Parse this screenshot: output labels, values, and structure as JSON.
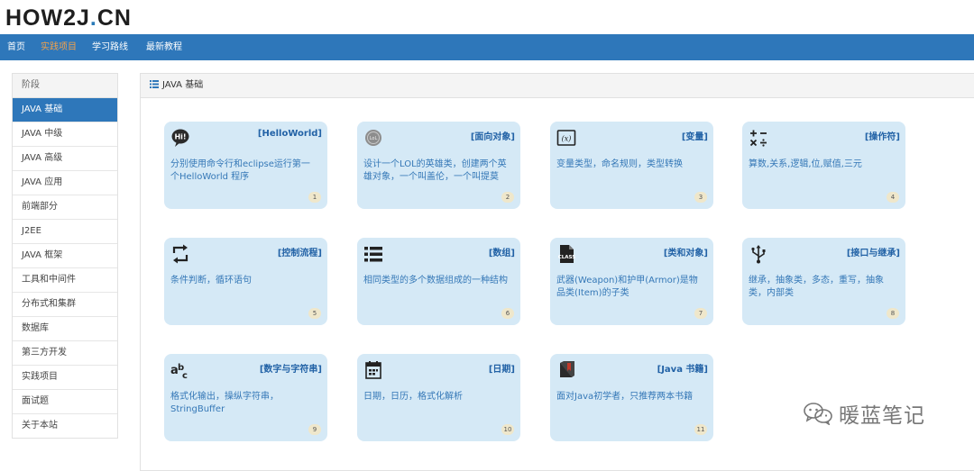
{
  "logo": {
    "text_a": "HOW2J",
    "text_dot": ".",
    "text_b": "CN"
  },
  "nav": {
    "items": [
      {
        "label": "首页",
        "active": false
      },
      {
        "label": "实践项目",
        "active": true
      },
      {
        "label": "学习路线",
        "active": false
      },
      {
        "label": "最新教程",
        "active": false
      }
    ]
  },
  "colors": {
    "nav_bg": "#2e77ba",
    "nav_active": "#f3a14a",
    "card_bg": "#d5e9f6",
    "card_title": "#2262a6",
    "card_text": "#3578b7"
  },
  "sidebar": {
    "header": "阶段",
    "items": [
      {
        "label": "JAVA 基础",
        "active": true
      },
      {
        "label": "JAVA 中级"
      },
      {
        "label": "JAVA 高级"
      },
      {
        "label": "JAVA 应用"
      },
      {
        "label": "前端部分"
      },
      {
        "label": "J2EE"
      },
      {
        "label": "JAVA 框架"
      },
      {
        "label": "工具和中间件"
      },
      {
        "label": "分布式和集群"
      },
      {
        "label": "数据库"
      },
      {
        "label": "第三方开发"
      },
      {
        "label": "实践项目"
      },
      {
        "label": "面试题"
      },
      {
        "label": "关于本站"
      }
    ]
  },
  "panel": {
    "title": "JAVA 基础",
    "title_icon": "list-icon"
  },
  "cards": [
    {
      "icon": "hi-bubble-icon",
      "title": "[HelloWorld]",
      "desc": "分别使用命令行和eclipse运行第一个HelloWorld 程序",
      "num": "1"
    },
    {
      "icon": "lol-icon",
      "title": "[面向对象]",
      "desc": "设计一个LOL的英雄类，创建两个英雄对象，一个叫盖伦，一个叫提莫",
      "num": "2"
    },
    {
      "icon": "variable-icon",
      "title": "[变量]",
      "desc": "变量类型，命名规则，类型转换",
      "num": "3"
    },
    {
      "icon": "operators-icon",
      "title": "[操作符]",
      "desc": "算数,关系,逻辑,位,赋值,三元",
      "num": "4"
    },
    {
      "icon": "loop-icon",
      "title": "[控制流程]",
      "desc": "条件判断，循环语句",
      "num": "5"
    },
    {
      "icon": "list-icon",
      "title": "[数组]",
      "desc": "相同类型的多个数据组成的一种结构",
      "num": "6"
    },
    {
      "icon": "class-file-icon",
      "title": "[类和对象]",
      "desc": "武器(Weapon)和护甲(Armor)是物品类(Item)的子类",
      "num": "7"
    },
    {
      "icon": "usb-icon",
      "title": "[接口与继承]",
      "desc": "继承，抽象类，多态，重写，抽象类，内部类",
      "num": "8"
    },
    {
      "icon": "abc-icon",
      "title": "[数字与字符串]",
      "desc": "格式化输出，操纵字符串，StringBuffer",
      "num": "9"
    },
    {
      "icon": "calendar-icon",
      "title": "[日期]",
      "desc": "日期，日历，格式化解析",
      "num": "10"
    },
    {
      "icon": "book-icon",
      "title": "[Java 书籍]",
      "desc": "面对Java初学者，只推荐两本书籍",
      "num": "11"
    }
  ],
  "watermark": {
    "icon": "wechat-icon",
    "text": "暖蓝笔记"
  }
}
